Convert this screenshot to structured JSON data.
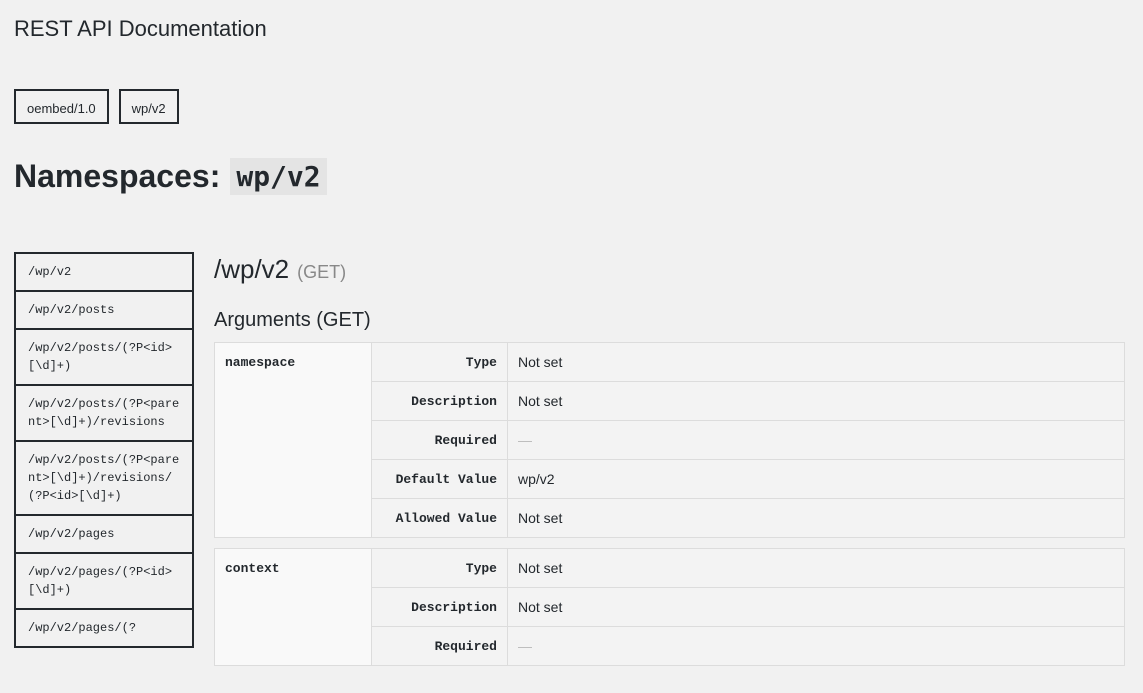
{
  "page": {
    "title": "REST API Documentation"
  },
  "namespaces": {
    "tabs": [
      {
        "label": "oembed/1.0"
      },
      {
        "label": "wp/v2"
      }
    ],
    "heading_prefix": "Namespaces:",
    "current": "wp/v2"
  },
  "routes": [
    "/wp/v2",
    "/wp/v2/posts",
    "/wp/v2/posts/(?P<id>[\\d]+)",
    "/wp/v2/posts/(?P<parent>[\\d]+)/revisions",
    "/wp/v2/posts/(?P<parent>[\\d]+)/revisions/(?P<id>[\\d]+)",
    "/wp/v2/pages",
    "/wp/v2/pages/(?P<id>[\\d]+)",
    "/wp/v2/pages/(?"
  ],
  "detail": {
    "route": "/wp/v2",
    "method": "(GET)",
    "args_title": "Arguments (GET)",
    "args": [
      {
        "name": "namespace",
        "rows": [
          {
            "key": "Type",
            "value": "Not set"
          },
          {
            "key": "Description",
            "value": "Not set"
          },
          {
            "key": "Required",
            "value": "—"
          },
          {
            "key": "Default Value",
            "value": "wp/v2"
          },
          {
            "key": "Allowed Value",
            "value": "Not set"
          }
        ]
      },
      {
        "name": "context",
        "rows": [
          {
            "key": "Type",
            "value": "Not set"
          },
          {
            "key": "Description",
            "value": "Not set"
          },
          {
            "key": "Required",
            "value": "—"
          }
        ]
      }
    ]
  }
}
